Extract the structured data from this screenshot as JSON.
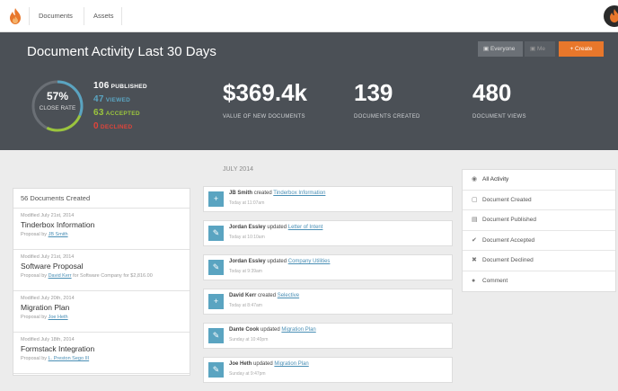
{
  "colors": {
    "accent": "#e8772b",
    "hero_bg": "#4b5056",
    "published": "#ffffff",
    "viewed": "#5aa4c1",
    "accepted": "#9bc53d",
    "declined": "#e0443a"
  },
  "nav": {
    "tabs": [
      "Documents",
      "Assets"
    ]
  },
  "hero": {
    "title": "Document Activity Last 30 Days",
    "filter_everyone": "Everyone",
    "filter_me": "Me",
    "create_label": "+ Create",
    "close_rate_pct": "57%",
    "close_rate_label": "CLOSE RATE",
    "close_rate_fraction": 0.57,
    "published_num": "106",
    "published_lbl": "PUBLISHED",
    "viewed_num": "47",
    "viewed_lbl": "VIEWED",
    "accepted_num": "63",
    "accepted_lbl": "ACCEPTED",
    "declined_num": "0",
    "declined_lbl": "DECLINED",
    "value": "$369.4k",
    "value_lbl": "VALUE OF NEW DOCUMENTS",
    "created": "139",
    "created_lbl": "DOCUMENTS CREATED",
    "views": "480",
    "views_lbl": "DOCUMENT VIEWS"
  },
  "timeline": {
    "month": "JULY 2014",
    "items": [
      {
        "icon": "+",
        "who": "JB Smith",
        "action": "created",
        "doc": "Tinderbox Information",
        "time": "Today at 11:07am"
      },
      {
        "icon": "✎",
        "who": "Jordan Essley",
        "action": "updated",
        "doc": "Letter of Intent",
        "time": "Today at 10:10am"
      },
      {
        "icon": "✎",
        "who": "Jordan Essley",
        "action": "updated",
        "doc": "Company Utilities",
        "time": "Today at 9:39am"
      },
      {
        "icon": "+",
        "who": "David Kerr",
        "action": "created",
        "doc": "Selective",
        "time": "Today at 8:47am"
      },
      {
        "icon": "✎",
        "who": "Dante Cook",
        "action": "updated",
        "doc": "Migration Plan",
        "time": "Sunday at 10:40pm"
      },
      {
        "icon": "✎",
        "who": "Joe Heth",
        "action": "updated",
        "doc": "Migration Plan",
        "time": "Sunday at 9:47pm"
      }
    ]
  },
  "created_list": {
    "header": "56 Documents Created",
    "items": [
      {
        "modified": "Modified July 21st, 2014",
        "title": "Tinderbox Information",
        "prefix": "Proposal by",
        "author": "JB Smith",
        "extra": ""
      },
      {
        "modified": "Modified July 21st, 2014",
        "title": "Software Proposal",
        "prefix": "Proposal by",
        "author": "David Kerr",
        "extra": "for Software Company for $2,816.00"
      },
      {
        "modified": "Modified July 20th, 2014",
        "title": "Migration Plan",
        "prefix": "Proposal by",
        "author": "Joe Heth",
        "extra": ""
      },
      {
        "modified": "Modified July 18th, 2014",
        "title": "Formstack Integration",
        "prefix": "Proposal by",
        "author": "L. Preston Sego III",
        "extra": ""
      }
    ]
  },
  "filters": [
    {
      "icon": "◉",
      "label": "All Activity"
    },
    {
      "icon": "▢",
      "label": "Document Created"
    },
    {
      "icon": "▤",
      "label": "Document Published"
    },
    {
      "icon": "✔",
      "label": "Document Accepted"
    },
    {
      "icon": "✖",
      "label": "Document Declined"
    },
    {
      "icon": "●",
      "label": "Comment"
    }
  ]
}
